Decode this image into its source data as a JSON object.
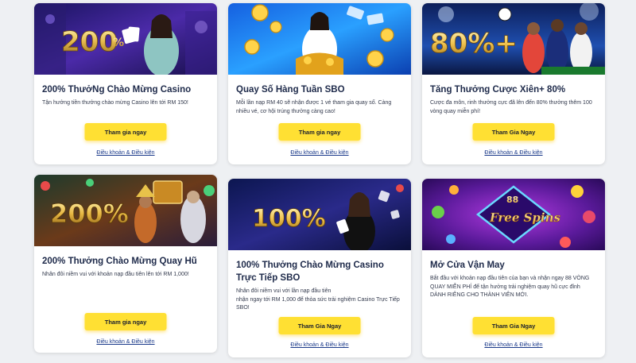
{
  "promotions": [
    {
      "banner_text": "200%",
      "title": "200% ThưởNg Chào Mừng Casino",
      "description": "Tận hưởng tiền thưởng chào mừng Casino lên tới RM 150!",
      "button_label": "Tham gia ngay",
      "terms_label": "Điều khoản & Điều kiện"
    },
    {
      "banner_text": "",
      "title": "Quay Số Hàng Tuần SBO",
      "description": "Mỗi lần nạp RM 40 sẽ nhận được 1 vé tham gia quay số. Càng nhiều vé, cơ hội trúng thưởng càng cao!",
      "button_label": "Tham gia ngay",
      "terms_label": "Điều khoản & Điều kiện"
    },
    {
      "banner_text": "80%+",
      "title": "Tăng Thưởng Cược Xiên+ 80%",
      "description": "Cược đa môn, rinh thưởng cực đã lên đến 80% thưởng thêm 100 vòng quay miễn phí!",
      "button_label": "Tham Gia Ngay",
      "terms_label": "Điều khoản & Điều kiện"
    },
    {
      "banner_text": "200%",
      "title": "200% Thưởng Chào Mừng Quay Hũ",
      "description": "Nhân đôi niềm vui với khoản nạp đầu tiên lên tới RM 1,000!",
      "button_label": "Tham gia ngay",
      "terms_label": "Điều khoản & Điều kiện"
    },
    {
      "banner_text": "100%",
      "title": "100% Thưởng Chào Mừng Casino Trực Tiếp SBO",
      "description_lines": [
        "Nhân đôi niềm vui với lần nạp đầu tiên",
        "nhận ngay tới RM 1,000 để thỏa sức trải nghiệm Casino Trực Tiếp SBO!"
      ],
      "button_label": "Tham Gia Ngay",
      "terms_label": "Điều khoản & Điều kiện"
    },
    {
      "banner_text_top": "88",
      "banner_text_main": "Free Spins",
      "title": "Mở Cửa Vận May",
      "description": "Bắt đầu với khoản nạp đầu tiên của bạn và nhận ngay 88 VÒNG QUAY MIỄN PHÍ để tận hưởng trải nghiệm quay hũ cực đỉnh DÀNH RIÊNG CHO THÀNH VIÊN MỚI.",
      "button_label": "Tham Gia Ngay",
      "terms_label": "Điều khoản & Điều kiện"
    }
  ],
  "colors": {
    "page_background": "#eef0f3",
    "card_background": "#ffffff",
    "title_color": "#1e2a4a",
    "button_yellow": "#ffe033",
    "link_blue": "#1b3a8a"
  }
}
